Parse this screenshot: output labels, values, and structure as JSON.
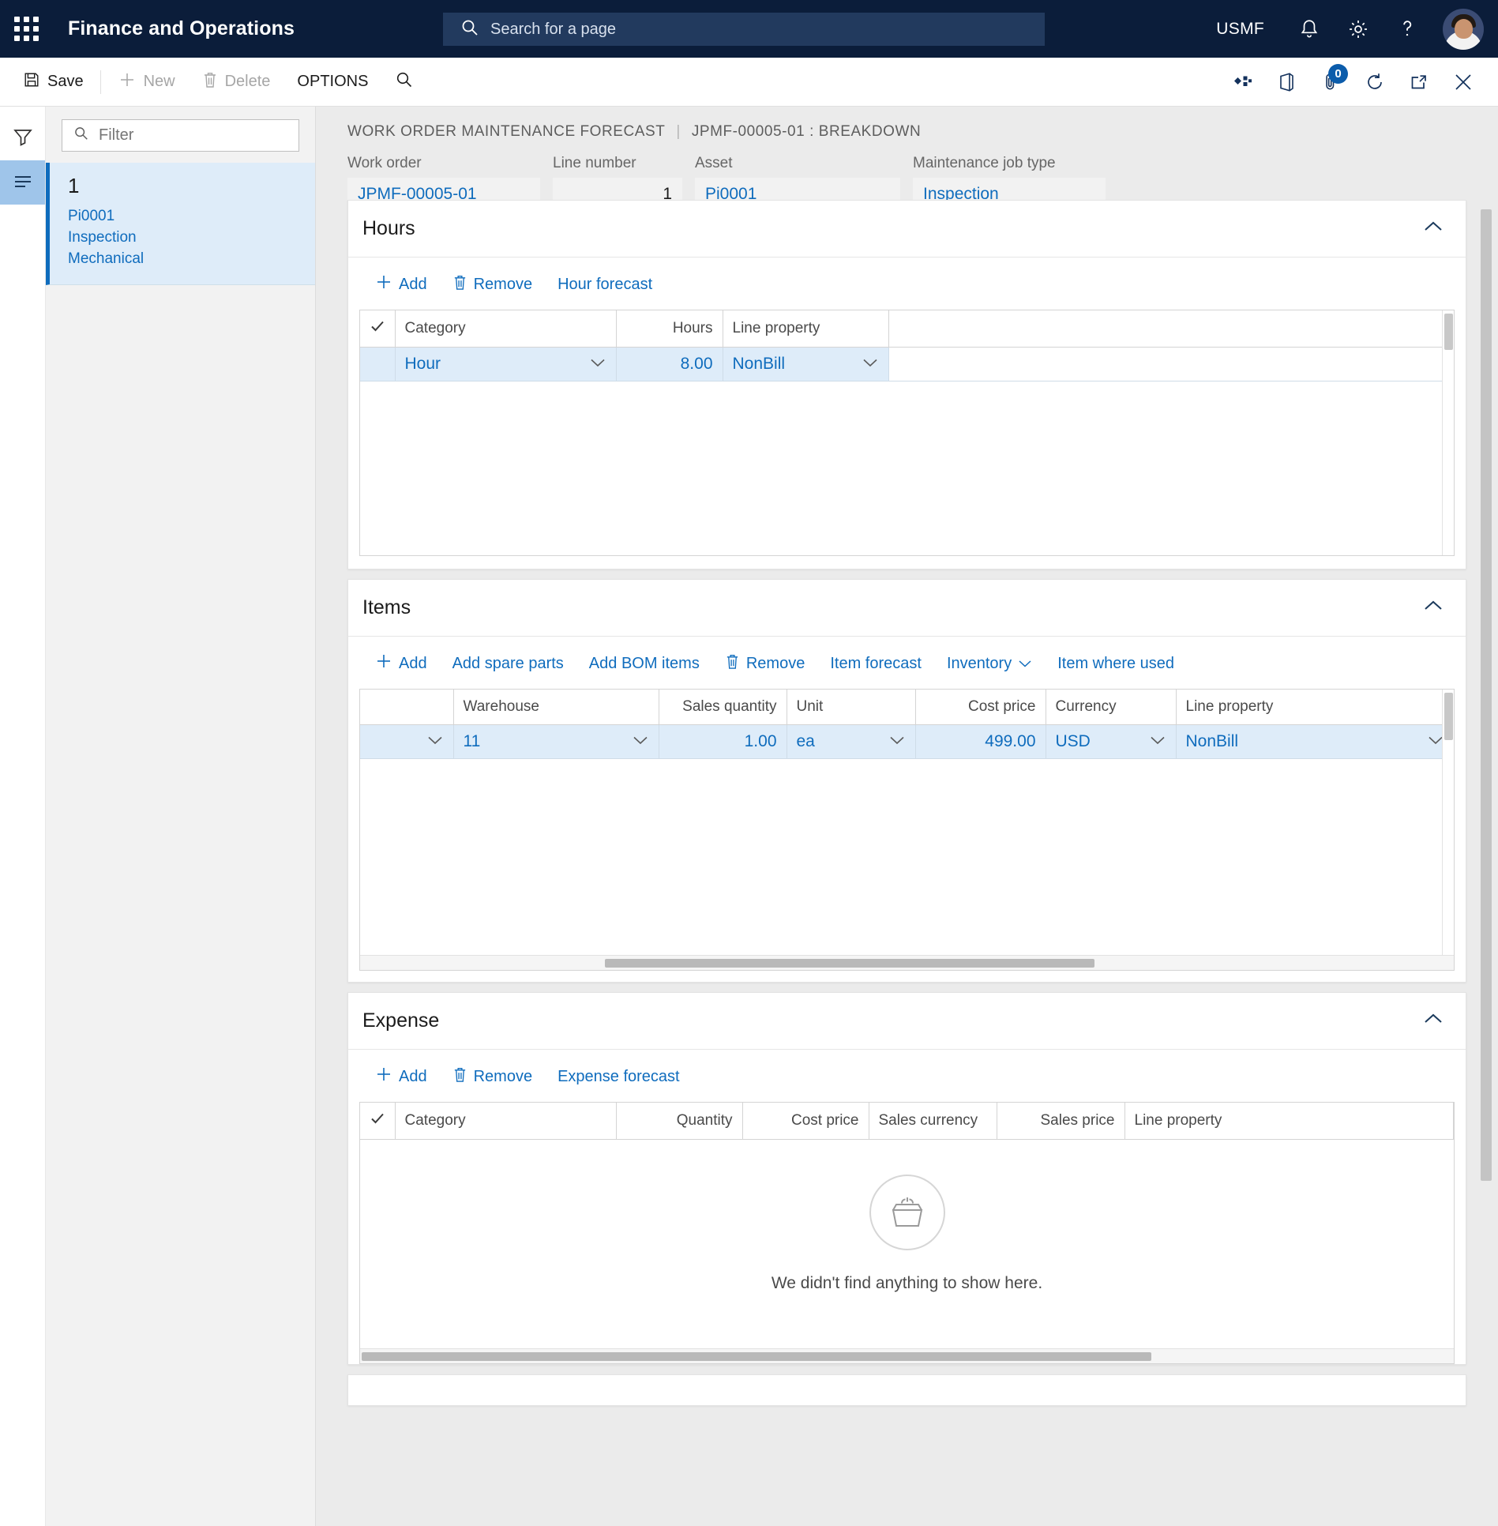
{
  "topnav": {
    "app_title": "Finance and Operations",
    "waffle_icon": "app-launcher-icon",
    "search_placeholder": "Search for a page",
    "search_value": "",
    "company": "USMF",
    "icons": [
      "notification-bell-icon",
      "settings-gear-icon",
      "help-question-icon"
    ],
    "avatar_label": "user-avatar"
  },
  "commandbar": {
    "save_label": "Save",
    "new_label": "New",
    "delete_label": "Delete",
    "options_label": "OPTIONS",
    "search_icon": "search-icon",
    "right_icons": [
      "dynamics-apps-icon",
      "office-icon",
      "attachments-icon",
      "refresh-icon",
      "open-in-new-window-icon",
      "close-icon"
    ],
    "attachment_badge": "0"
  },
  "leftpane": {
    "filter_placeholder": "Filter",
    "filter_value": "",
    "records": [
      {
        "title": "1",
        "lines": [
          "Pi0001",
          "Inspection",
          "Mechanical"
        ]
      }
    ]
  },
  "rail": {
    "filter_icon": "filter-funnel-icon",
    "list_icon": "list-lines-icon"
  },
  "breadcrumb": {
    "page": "WORK ORDER MAINTENANCE FORECAST",
    "separator": "|",
    "record": "JPMF-00005-01 : BREAKDOWN"
  },
  "header_fields": [
    {
      "label": "Work order",
      "value": "JPMF-00005-01",
      "align": "left"
    },
    {
      "label": "Line number",
      "value": "1",
      "align": "right"
    },
    {
      "label": "Asset",
      "value": "Pi0001",
      "align": "left"
    },
    {
      "label": "Maintenance job type",
      "value": "Inspection",
      "align": "left"
    }
  ],
  "hours_section": {
    "title": "Hours",
    "collapse_icon": "chevron-up-icon",
    "toolbar": [
      {
        "label": "Add",
        "icon": "plus-icon"
      },
      {
        "label": "Remove",
        "icon": "trash-icon"
      },
      {
        "label": "Hour forecast",
        "icon": ""
      }
    ],
    "columns": [
      "Category",
      "Hours",
      "Line property"
    ],
    "rows": [
      {
        "category": "Hour",
        "hours": "8.00",
        "line_property": "NonBill"
      }
    ]
  },
  "items_section": {
    "title": "Items",
    "collapse_icon": "chevron-up-icon",
    "toolbar": [
      {
        "label": "Add",
        "icon": "plus-icon"
      },
      {
        "label": "Add spare parts",
        "icon": ""
      },
      {
        "label": "Add BOM items",
        "icon": ""
      },
      {
        "label": "Remove",
        "icon": "trash-icon"
      },
      {
        "label": "Item forecast",
        "icon": ""
      },
      {
        "label": "Inventory",
        "icon": "chevron-down-icon"
      },
      {
        "label": "Item where used",
        "icon": ""
      }
    ],
    "columns": [
      "",
      "Warehouse",
      "Sales quantity",
      "Unit",
      "Cost price",
      "Currency",
      "Line property"
    ],
    "rows": [
      {
        "lookup": "",
        "warehouse": "11",
        "sales_quantity": "1.00",
        "unit": "ea",
        "cost_price": "499.00",
        "currency": "USD",
        "line_property": "NonBill"
      }
    ]
  },
  "expense_section": {
    "title": "Expense",
    "collapse_icon": "chevron-up-icon",
    "toolbar": [
      {
        "label": "Add",
        "icon": "plus-icon"
      },
      {
        "label": "Remove",
        "icon": "trash-icon"
      },
      {
        "label": "Expense forecast",
        "icon": ""
      }
    ],
    "columns": [
      "Category",
      "Quantity",
      "Cost price",
      "Sales currency",
      "Sales price",
      "Line property"
    ],
    "empty_message": "We didn't find anything to show here.",
    "empty_icon": "empty-basket-icon"
  },
  "colors": {
    "nav_background": "#0b1d3a",
    "accent_link": "#0f6cbd",
    "selected_row": "#deecf9",
    "page_background": "#ebebeb"
  }
}
